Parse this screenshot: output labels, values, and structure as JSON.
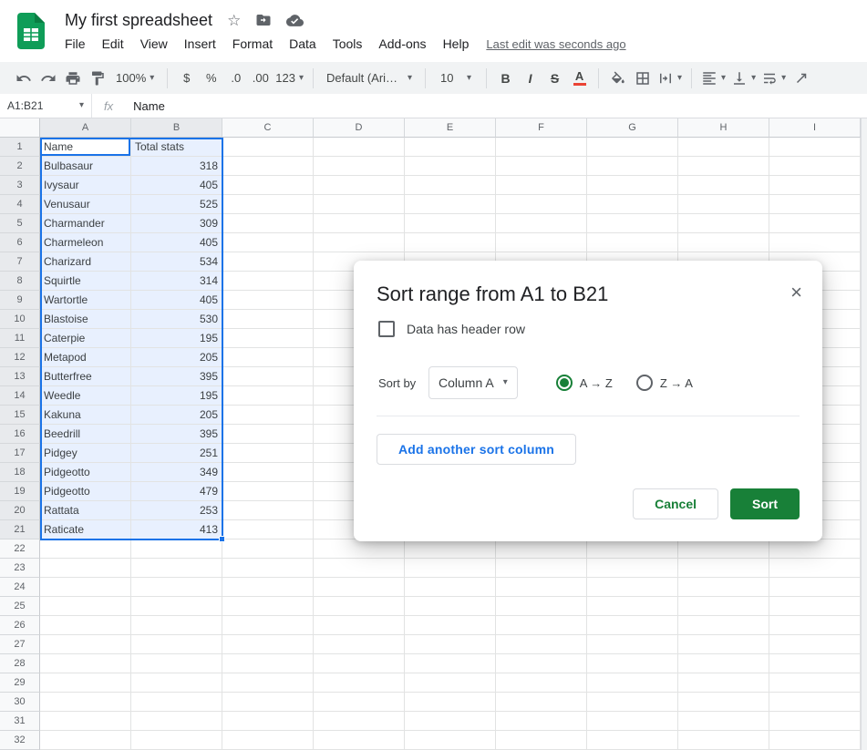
{
  "app": {
    "title": "My first spreadsheet",
    "menu": [
      "File",
      "Edit",
      "View",
      "Insert",
      "Format",
      "Data",
      "Tools",
      "Add-ons",
      "Help"
    ],
    "last_edit": "Last edit was seconds ago"
  },
  "icons": {
    "star": "☆",
    "dropdown": "▾",
    "close": "×"
  },
  "toolbar": {
    "zoom": "100%",
    "currency": "$",
    "percent": "%",
    "decimal_decrease": ".0",
    "decimal_increase": ".00",
    "more_formats": "123",
    "font_name": "Default (Ari…",
    "font_size": "10",
    "bold": "B",
    "italic": "I",
    "strikethrough": "S",
    "text_color": "A"
  },
  "formula_bar": {
    "name_box": "A1:B21",
    "fx_label": "fx",
    "value": "Name"
  },
  "sheet": {
    "visible_columns": [
      "A",
      "B",
      "C",
      "D",
      "E",
      "F",
      "G",
      "H",
      "I"
    ],
    "visible_rows": 32,
    "selection": "A1:B21",
    "columns": [
      "Name",
      "Total stats"
    ],
    "rows": [
      [
        "Bulbasaur",
        "318"
      ],
      [
        "Ivysaur",
        "405"
      ],
      [
        "Venusaur",
        "525"
      ],
      [
        "Charmander",
        "309"
      ],
      [
        "Charmeleon",
        "405"
      ],
      [
        "Charizard",
        "534"
      ],
      [
        "Squirtle",
        "314"
      ],
      [
        "Wartortle",
        "405"
      ],
      [
        "Blastoise",
        "530"
      ],
      [
        "Caterpie",
        "195"
      ],
      [
        "Metapod",
        "205"
      ],
      [
        "Butterfree",
        "395"
      ],
      [
        "Weedle",
        "195"
      ],
      [
        "Kakuna",
        "205"
      ],
      [
        "Beedrill",
        "395"
      ],
      [
        "Pidgey",
        "251"
      ],
      [
        "Pidgeotto",
        "349"
      ],
      [
        "Pidgeotto",
        "479"
      ],
      [
        "Rattata",
        "253"
      ],
      [
        "Raticate",
        "413"
      ]
    ]
  },
  "dialog": {
    "title": "Sort range from A1 to B21",
    "close": "×",
    "header_checkbox": "Data has header row",
    "header_checkbox_checked": false,
    "sort_by": "Sort by",
    "column": "Column A",
    "asc": "A → Z",
    "desc": "Z → A",
    "asc_selected": true,
    "add_column": "Add another sort column",
    "cancel": "Cancel",
    "sort": "Sort"
  },
  "colors": {
    "accent_green": "#188038",
    "link_blue": "#1a73e8",
    "selection_border": "#1a73e8",
    "selection_fill": "#e8f0fe",
    "logo_green": "#0f9d58",
    "text_color_indicator": "#ea4335",
    "toolbar_bg": "#f1f3f4"
  }
}
